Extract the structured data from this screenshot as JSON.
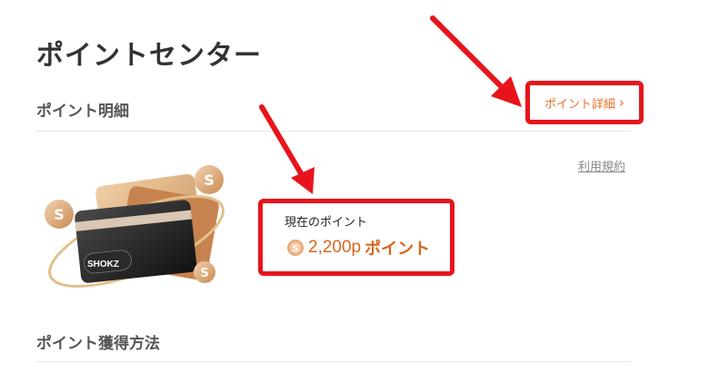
{
  "page": {
    "title": "ポイントセンター"
  },
  "sections": {
    "points_detail": "ポイント明細",
    "earn_methods": "ポイント獲得方法"
  },
  "links": {
    "points_detail_link": "ポイント詳細",
    "terms": "利用規約"
  },
  "points": {
    "label": "現在のポイント",
    "value": "2,200p",
    "unit": "ポイント"
  },
  "card": {
    "brand": "SHOKZ"
  },
  "colors": {
    "accent": "#d9651c",
    "annotation": "#e8141c"
  },
  "icons": {
    "coin": "coin-icon",
    "chevron": "chevron-right-icon"
  }
}
